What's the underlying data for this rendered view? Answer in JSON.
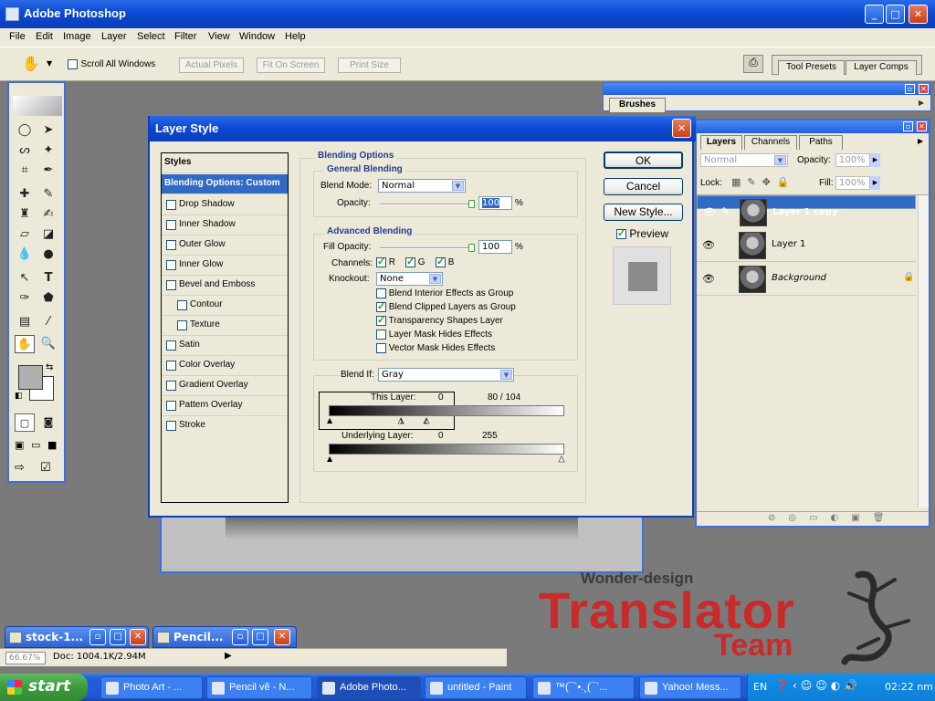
{
  "app": {
    "title": "Adobe Photoshop"
  },
  "menu": [
    "File",
    "Edit",
    "Image",
    "Layer",
    "Select",
    "Filter",
    "View",
    "Window",
    "Help"
  ],
  "options_bar": {
    "scroll_all_windows": "Scroll All Windows",
    "scroll_all_checked": false,
    "actual_pixels": "Actual Pixels",
    "fit_on_screen": "Fit On Screen",
    "print_size": "Print Size",
    "tool_presets_tab": "Tool Presets",
    "layer_comps_tab": "Layer Comps"
  },
  "dialog": {
    "title": "Layer Style",
    "styles_header": "Styles",
    "items": [
      {
        "label": "Blending Options: Custom",
        "selected": true,
        "checkbox": false
      },
      {
        "label": "Drop Shadow",
        "checked": false
      },
      {
        "label": "Inner Shadow",
        "checked": false
      },
      {
        "label": "Outer Glow",
        "checked": false
      },
      {
        "label": "Inner Glow",
        "checked": false
      },
      {
        "label": "Bevel and Emboss",
        "checked": false
      },
      {
        "label": "Contour",
        "checked": false,
        "indent": true
      },
      {
        "label": "Texture",
        "checked": false,
        "indent": true
      },
      {
        "label": "Satin",
        "checked": false
      },
      {
        "label": "Color Overlay",
        "checked": false
      },
      {
        "label": "Gradient Overlay",
        "checked": false
      },
      {
        "label": "Pattern Overlay",
        "checked": false
      },
      {
        "label": "Stroke",
        "checked": false
      }
    ],
    "blending_options_title": "Blending Options",
    "general_blending_title": "General Blending",
    "blend_mode_label": "Blend Mode:",
    "blend_mode_value": "Normal",
    "opacity_label": "Opacity:",
    "opacity_value": "100",
    "percent": "%",
    "advanced_blending_title": "Advanced Blending",
    "fill_opacity_label": "Fill Opacity:",
    "fill_opacity_value": "100",
    "channels_label": "Channels:",
    "channel_r": "R",
    "channel_g": "G",
    "channel_b": "B",
    "knockout_label": "Knockout:",
    "knockout_value": "None",
    "options": [
      {
        "label": "Blend Interior Effects as Group",
        "checked": false
      },
      {
        "label": "Blend Clipped Layers as Group",
        "checked": true
      },
      {
        "label": "Transparency Shapes Layer",
        "checked": true
      },
      {
        "label": "Layer Mask Hides Effects",
        "checked": false
      },
      {
        "label": "Vector Mask Hides Effects",
        "checked": false
      }
    ],
    "blend_if_label": "Blend If:",
    "blend_if_value": "Gray",
    "this_layer_label": "This Layer:",
    "this_layer_low": "0",
    "this_layer_high": "80 / 104",
    "underlying_label": "Underlying Layer:",
    "underlying_low": "0",
    "underlying_high": "255",
    "ok": "OK",
    "cancel": "Cancel",
    "new_style": "New Style...",
    "preview_label": "Preview",
    "preview_checked": true
  },
  "brushes_panel": {
    "tab": "Brushes"
  },
  "layers_panel": {
    "tabs": [
      "Layers",
      "Channels",
      "Paths"
    ],
    "mode": "Normal",
    "opacity_label": "Opacity:",
    "opacity_value": "100%",
    "lock_label": "Lock:",
    "fill_label": "Fill:",
    "fill_value": "100%",
    "layers": [
      {
        "name": "Layer 1 copy",
        "selected": true
      },
      {
        "name": "Layer 1",
        "selected": false
      },
      {
        "name": "Background",
        "selected": false,
        "italic": true
      }
    ]
  },
  "minimized": [
    {
      "title": "stock-1..."
    },
    {
      "title": "Pencil..."
    }
  ],
  "status": {
    "zoom": "66.67%",
    "doc": "Doc: 1004.1K/2.94M"
  },
  "taskbar": {
    "start": "start",
    "tasks": [
      {
        "label": "Photo Art - ...",
        "active": false
      },
      {
        "label": "Pencil vẽ - N...",
        "active": false
      },
      {
        "label": "Adobe Photo...",
        "active": true
      },
      {
        "label": "untitled - Paint",
        "active": false
      },
      {
        "label": "™(¯`•.¸(¯`...",
        "active": false
      },
      {
        "label": "Yahoo! Mess...",
        "active": false
      }
    ],
    "lang": "EN",
    "clock": "02:22 nm"
  },
  "watermark": {
    "line1": "Wonder-design",
    "line2": "Translator",
    "line3": "Team"
  }
}
